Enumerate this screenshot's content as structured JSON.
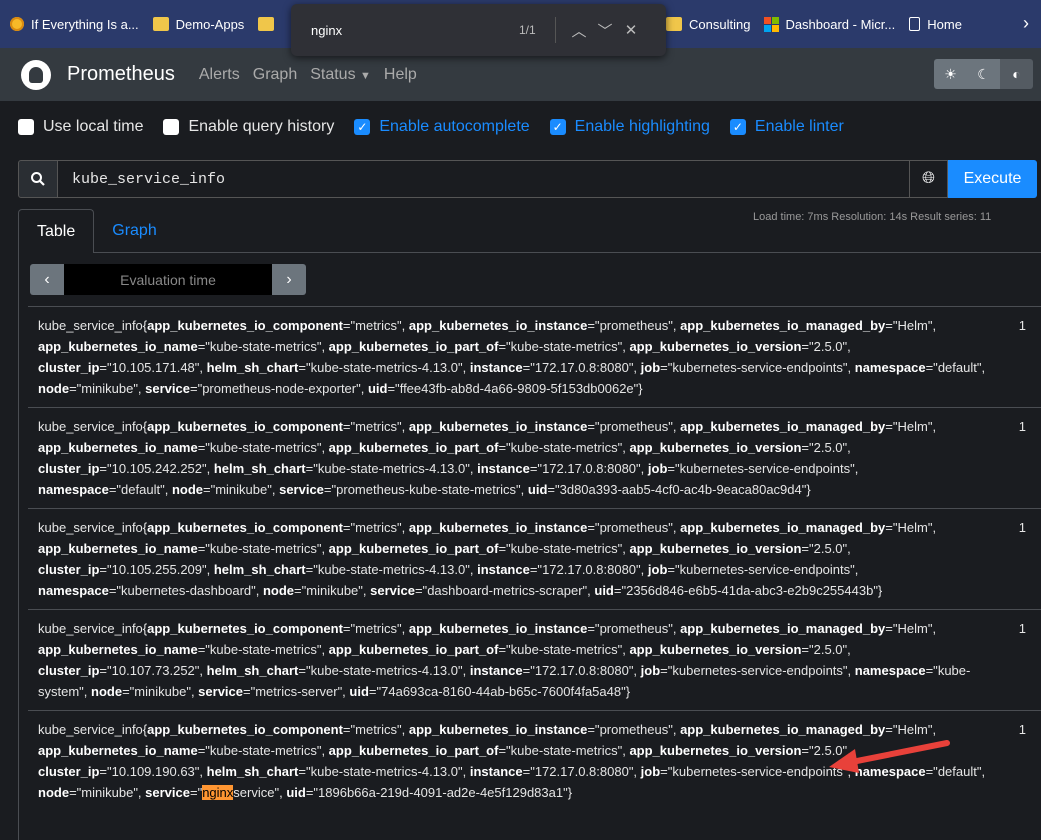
{
  "bookmarks": [
    {
      "label": "If Everything Is a...",
      "icon": "sun-icon"
    },
    {
      "label": "Demo-Apps",
      "icon": "folder-icon"
    }
  ],
  "bookmarks_right": [
    {
      "label": "Consulting",
      "icon": "folder-icon"
    },
    {
      "label": "Dashboard - Micr...",
      "icon": "microsoft-icon"
    },
    {
      "label": "Home",
      "icon": "page-icon"
    }
  ],
  "find": {
    "query": "nginx",
    "count": "1/1"
  },
  "navbar": {
    "brand": "Prometheus",
    "links": [
      "Alerts",
      "Graph",
      "Status",
      "Help"
    ]
  },
  "options": [
    {
      "label": "Use local time",
      "checked": false
    },
    {
      "label": "Enable query history",
      "checked": false
    },
    {
      "label": "Enable autocomplete",
      "checked": true
    },
    {
      "label": "Enable highlighting",
      "checked": true
    },
    {
      "label": "Enable linter",
      "checked": true
    }
  ],
  "query": {
    "expression": "kube_service_info",
    "execute_label": "Execute"
  },
  "tabs": {
    "table": "Table",
    "graph": "Graph"
  },
  "stats": "Load time: 7ms   Resolution: 14s   Result series: 11",
  "eval": {
    "placeholder": "Evaluation time"
  },
  "metric": "kube_service_info",
  "results": [
    {
      "cluster_ip": "10.105.171.48",
      "namespace": "default",
      "service_pre": "prometheus-node-exporter",
      "service_hl": "",
      "service_post": "",
      "uid": "ffee43fb-ab8d-4a66-9809-5f153db0062e",
      "value": "1"
    },
    {
      "cluster_ip": "10.105.242.252",
      "namespace": "default",
      "service_pre": "prometheus-kube-state-metrics",
      "service_hl": "",
      "service_post": "",
      "uid": "3d80a393-aab5-4cf0-ac4b-9eaca80ac9d4",
      "value": "1"
    },
    {
      "cluster_ip": "10.105.255.209",
      "namespace": "kubernetes-dashboard",
      "service_pre": "dashboard-metrics-scraper",
      "service_hl": "",
      "service_post": "",
      "uid": "2356d846-e6b5-41da-abc3-e2b9c255443b",
      "value": "1"
    },
    {
      "cluster_ip": "10.107.73.252",
      "namespace": "kube-system",
      "service_pre": "metrics-server",
      "service_hl": "",
      "service_post": "",
      "uid": "74a693ca-8160-44ab-b65c-7600f4fa5a48",
      "value": "1"
    },
    {
      "cluster_ip": "10.109.190.63",
      "namespace": "default",
      "service_pre": "",
      "service_hl": "nginx",
      "service_post": "service",
      "uid": "1896b66a-219d-4091-ad2e-4e5f129d83a1",
      "value": "1"
    }
  ],
  "common_labels": {
    "component": "metrics",
    "instance_label": "prometheus",
    "managed_by": "Helm",
    "name": "kube-state-metrics",
    "part_of": "kube-state-metrics",
    "version": "2.5.0",
    "helm_chart": "kube-state-metrics-4.13.0",
    "instance": "172.17.0.8:8080",
    "job": "kubernetes-service-endpoints",
    "node": "minikube"
  },
  "colors": {
    "accent": "#1a8cff",
    "highlight": "#ff9632",
    "annotation_arrow": "#e8413a"
  }
}
